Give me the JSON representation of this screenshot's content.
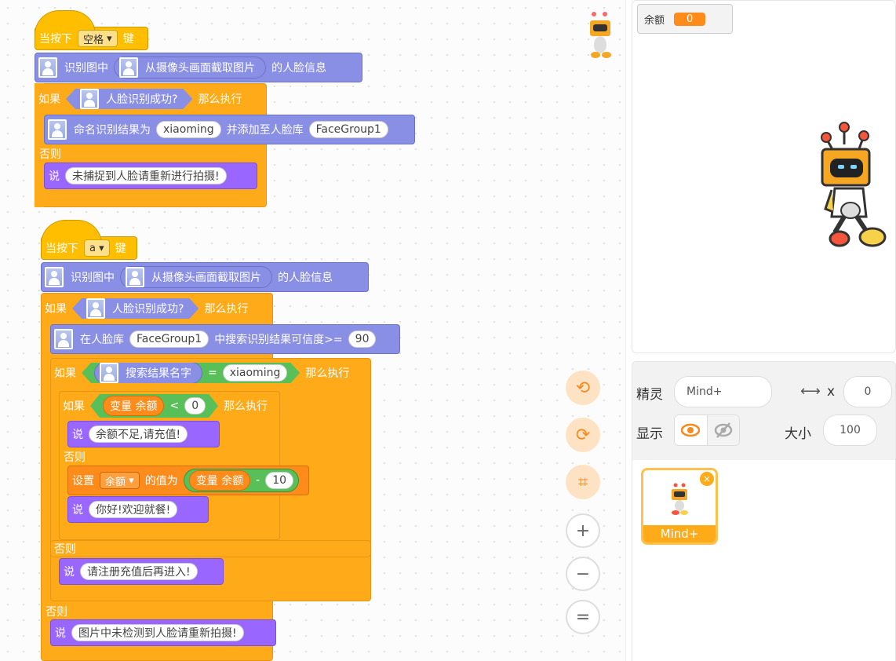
{
  "script1": {
    "hat": {
      "prefix": "当按下",
      "key": "空格",
      "suffix": "键"
    },
    "recognize": {
      "prefix": "识别图中",
      "reporter": "从摄像头画面截取图片",
      "suffix": "的人脸信息"
    },
    "if": {
      "label": "如果",
      "cond": "人脸识别成功?",
      "then": "那么执行"
    },
    "name": {
      "prefix": "命名识别结果为",
      "name_value": "xiaoming",
      "middle": "并添加至人脸库",
      "lib_value": "FaceGroup1"
    },
    "else": "否则",
    "say": {
      "label": "说",
      "text": "未捕捉到人脸请重新进行拍摄!"
    }
  },
  "script2": {
    "hat": {
      "prefix": "当按下",
      "key": "a",
      "suffix": "键"
    },
    "recognize": {
      "prefix": "识别图中",
      "reporter": "从摄像头画面截取图片",
      "suffix": "的人脸信息"
    },
    "if1": {
      "label": "如果",
      "cond": "人脸识别成功?",
      "then": "那么执行"
    },
    "search": {
      "prefix": "在人脸库",
      "lib_value": "FaceGroup1",
      "middle": "中搜索识别结果可信度>=",
      "threshold": "90"
    },
    "if2": {
      "label": "如果",
      "reporter": "搜索结果名字",
      "op": "=",
      "value": "xiaoming",
      "then": "那么执行"
    },
    "if3": {
      "label": "如果",
      "var_prefix": "变量",
      "var_name": "余额",
      "op": "<",
      "value": "0",
      "then": "那么执行"
    },
    "say1": {
      "label": "说",
      "text": "余额不足,请充值!"
    },
    "else1": "否则",
    "set": {
      "prefix": "设置",
      "var": "余额",
      "middle": "的值为",
      "var_prefix": "变量",
      "var_name": "余额",
      "op": "-",
      "value": "10"
    },
    "say2": {
      "label": "说",
      "text": "你好!欢迎就餐!"
    },
    "else2": "否则",
    "say3": {
      "label": "说",
      "text": "请注册充值后再进入!"
    },
    "else3": "否则",
    "say4": {
      "label": "说",
      "text": "图片中未检测到人脸请重新拍摄!"
    }
  },
  "zoom": {
    "undo": "⟲",
    "redo": "⟳",
    "crop": "⌗",
    "zoom_in": "+",
    "zoom_out": "−",
    "reset": "="
  },
  "stage": {
    "monitor_label": "余额",
    "monitor_value": "0"
  },
  "sprite_panel": {
    "sprite_label": "精灵",
    "sprite_name": "Mind+",
    "x_label": "x",
    "x_value": "0",
    "show_label": "显示",
    "size_label": "大小",
    "size_value": "100",
    "thumb_name": "Mind+"
  },
  "colors": {
    "event": "#ffbf00",
    "control": "#ffab19",
    "ai": "#8a8fe6",
    "looks": "#9966ff",
    "variable": "#ff8c1a",
    "operator": "#59c059"
  }
}
